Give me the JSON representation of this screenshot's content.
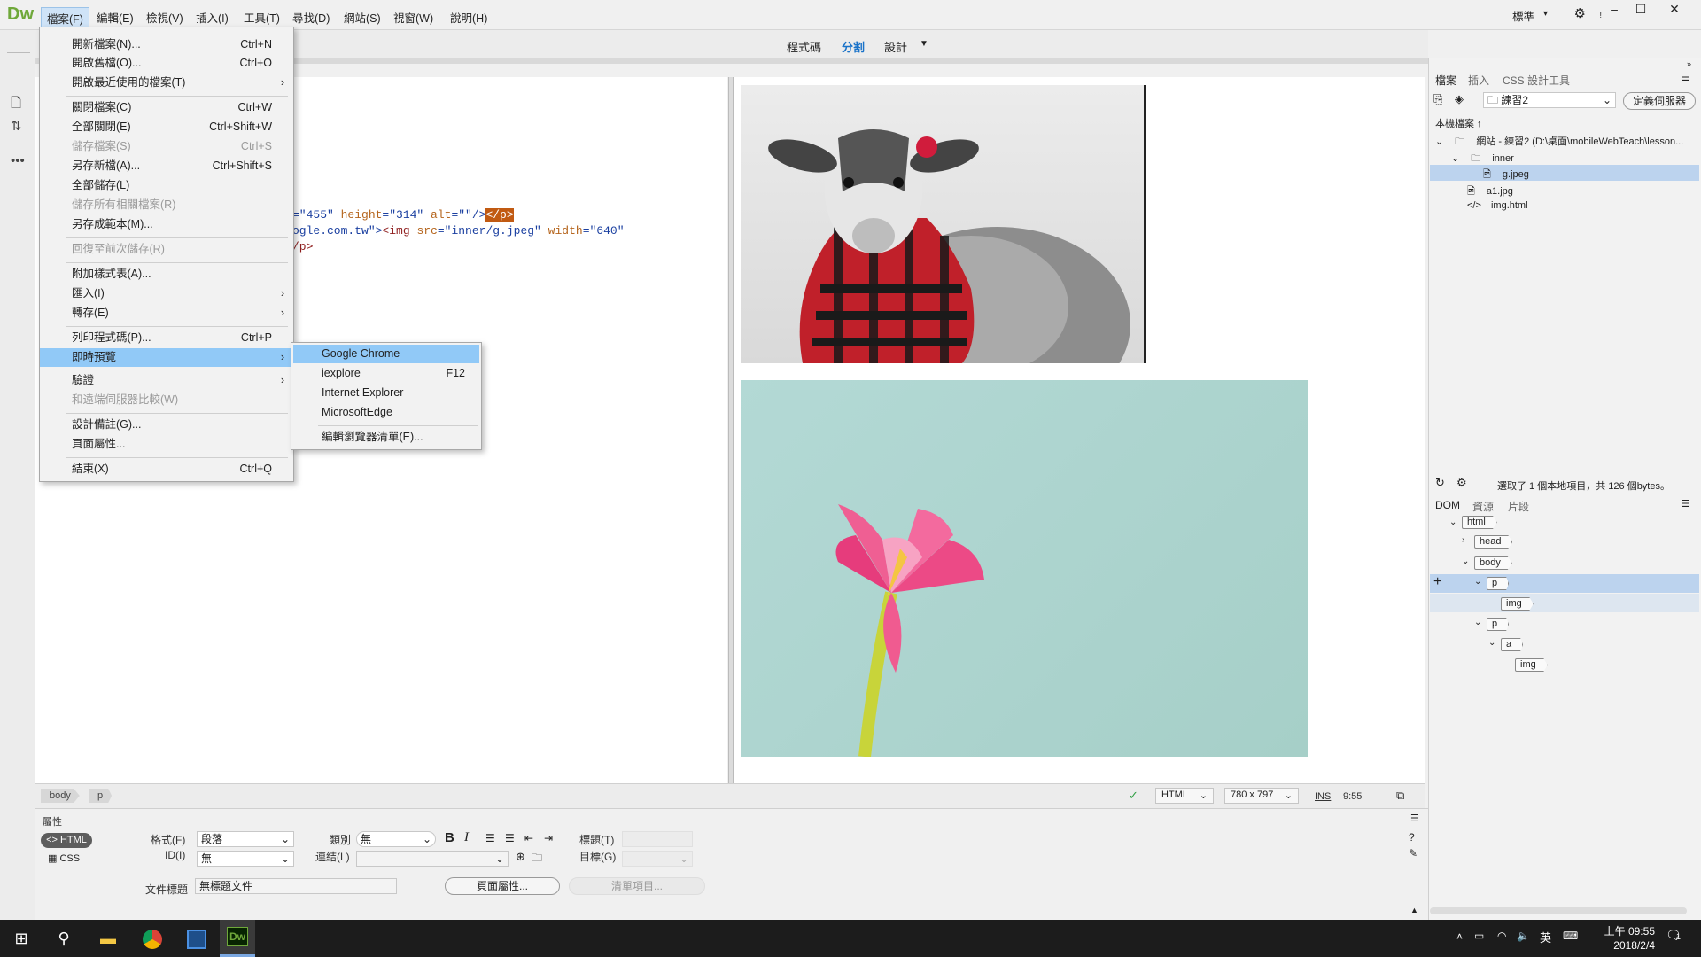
{
  "app": {
    "logo": "Dw",
    "workspace": "標準"
  },
  "menubar": [
    "檔案(F)",
    "編輯(E)",
    "檢視(V)",
    "插入(I)",
    "工具(T)",
    "尋找(D)",
    "網站(S)",
    "視窗(W)",
    "說明(H)"
  ],
  "viewtabs": {
    "code": "程式碼",
    "split": "分割",
    "design": "設計"
  },
  "code": {
    "line1_a": "=\"455\" ",
    "line1_b": "height",
    "line1_c": "=\"314\" ",
    "line1_d": "alt",
    "line1_e": "=\"\"/>",
    "line1_f": "</p>",
    "line2_a": "ogle.com.tw\">",
    "line2_b": "<img ",
    "line2_c": "src",
    "line2_d": "=\"inner/g.jpeg\" ",
    "line2_e": "width",
    "line2_f": "=\"640\"",
    "line3": "/p>"
  },
  "file_menu": {
    "items": [
      {
        "label": "開新檔案(N)...",
        "shortcut": "Ctrl+N"
      },
      {
        "label": "開啟舊檔(O)...",
        "shortcut": "Ctrl+O"
      },
      {
        "label": "開啟最近使用的檔案(T)",
        "shortcut": ""
      },
      {
        "label": "關閉檔案(C)",
        "shortcut": "Ctrl+W"
      },
      {
        "label": "全部關閉(E)",
        "shortcut": "Ctrl+Shift+W"
      },
      {
        "label": "儲存檔案(S)",
        "shortcut": "Ctrl+S"
      },
      {
        "label": "另存新檔(A)...",
        "shortcut": "Ctrl+Shift+S"
      },
      {
        "label": "全部儲存(L)",
        "shortcut": ""
      },
      {
        "label": "儲存所有相關檔案(R)",
        "shortcut": ""
      },
      {
        "label": "另存成範本(M)...",
        "shortcut": ""
      },
      {
        "label": "回復至前次儲存(R)",
        "shortcut": ""
      },
      {
        "label": "附加樣式表(A)...",
        "shortcut": ""
      },
      {
        "label": "匯入(I)",
        "shortcut": ""
      },
      {
        "label": "轉存(E)",
        "shortcut": ""
      },
      {
        "label": "列印程式碼(P)...",
        "shortcut": "Ctrl+P"
      },
      {
        "label": "即時預覽",
        "shortcut": ""
      },
      {
        "label": "驗證",
        "shortcut": ""
      },
      {
        "label": "和遠端伺服器比較(W)",
        "shortcut": ""
      },
      {
        "label": "設計備註(G)...",
        "shortcut": ""
      },
      {
        "label": "頁面屬性...",
        "shortcut": ""
      },
      {
        "label": "結束(X)",
        "shortcut": "Ctrl+Q"
      }
    ]
  },
  "preview_submenu": [
    {
      "label": "Google Chrome",
      "shortcut": ""
    },
    {
      "label": "iexplore",
      "shortcut": "F12"
    },
    {
      "label": "Internet Explorer",
      "shortcut": ""
    },
    {
      "label": "MicrosoftEdge",
      "shortcut": ""
    },
    {
      "label": "編輯瀏覽器清單(E)...",
      "shortcut": ""
    }
  ],
  "status": {
    "crumb_body": "body",
    "crumb_p": "p",
    "doctype": "HTML",
    "size": "780 x 797",
    "mode": "INS",
    "position": "9:55"
  },
  "properties": {
    "title": "屬性",
    "html_btn": "HTML",
    "css_btn": "CSS",
    "format_label": "格式(F)",
    "format_value": "段落",
    "id_label": "ID(I)",
    "id_value": "無",
    "class_label": "類別",
    "class_value": "無",
    "link_label": "連結(L)",
    "target_label": "目標(G)",
    "heading_label": "標題(T)",
    "doc_title_label": "文件標題",
    "doc_title_value": "無標題文件",
    "page_props_btn": "頁面屬性...",
    "list_item_btn": "清單項目..."
  },
  "files_panel": {
    "tabs": [
      "檔案",
      "插入",
      "CSS 設計工具"
    ],
    "site": "練習2",
    "define_server": "定義伺服器",
    "local_files": "本機檔案 ↑",
    "site_root": "網站 - 練習2 (D:\\桌面\\mobileWebTeach\\lesson...",
    "folder_inner": "inner",
    "file_g": "g.jpeg",
    "file_a1": "a1.jpg",
    "file_img": "img.html",
    "status": "選取了 1 個本地項目，共 126 個bytes。"
  },
  "dom_panel": {
    "tabs": [
      "DOM",
      "資源",
      "片段"
    ],
    "nodes": {
      "html": "html",
      "head": "head",
      "body": "body",
      "p1": "p",
      "img1": "img",
      "p2": "p",
      "a": "a",
      "img2": "img"
    }
  },
  "taskbar": {
    "time": "上午 09:55",
    "date": "2018/2/4",
    "ime": "英",
    "notify": "1"
  }
}
